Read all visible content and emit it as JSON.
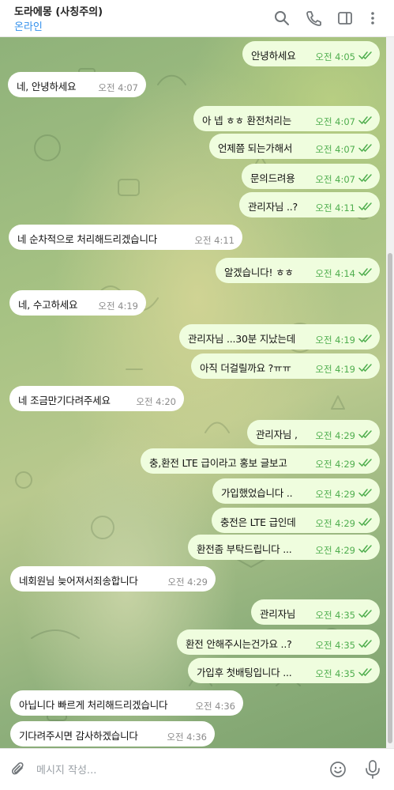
{
  "header": {
    "chat_name": "도라에몽 (사칭주의)",
    "status": "온라인",
    "icons": [
      "search-icon",
      "phone-icon",
      "sidebar-icon",
      "more-icon"
    ]
  },
  "messages": [
    {
      "dir": "out",
      "text": "안녕하세요",
      "time": "오전 4:05",
      "read": true
    },
    {
      "dir": "in",
      "text": "네, 안녕하세요",
      "time": "오전 4:07"
    },
    {
      "dir": "out",
      "text": "아 넵 ㅎㅎ 환전처리는",
      "time": "오전 4:07",
      "read": true
    },
    {
      "dir": "out",
      "text": "언제쯤 되는가해서",
      "time": "오전 4:07",
      "read": true
    },
    {
      "dir": "out",
      "text": "문의드려용",
      "time": "오전 4:07",
      "read": true
    },
    {
      "dir": "out",
      "text": "관리자님 ..?",
      "time": "오전 4:11",
      "read": true
    },
    {
      "dir": "in",
      "text": "네 순차적으로 처리해드리겠습니다",
      "time": "오전 4:11"
    },
    {
      "dir": "out",
      "text": "알겠습니다! ㅎㅎ",
      "time": "오전 4:14",
      "read": true
    },
    {
      "dir": "in",
      "text": "네, 수고하세요",
      "time": "오전 4:19"
    },
    {
      "dir": "out",
      "text": "관리자님 ...30분 지났는데",
      "time": "오전 4:19",
      "read": true
    },
    {
      "dir": "out",
      "text": "아직 더걸릴까요 ?ㅠㅠ",
      "time": "오전 4:19",
      "read": true
    },
    {
      "dir": "in",
      "text": "네 조금만기다려주세요",
      "time": "오전 4:20"
    },
    {
      "dir": "out",
      "text": "관리자님 ,",
      "time": "오전 4:29",
      "read": true
    },
    {
      "dir": "out",
      "text": "충,환전 LTE 급이라고 홍보 글보고",
      "time": "오전 4:29",
      "read": true
    },
    {
      "dir": "out",
      "text": "가입했었습니다 ..",
      "time": "오전 4:29",
      "read": true
    },
    {
      "dir": "out",
      "text": "충전은 LTE 급인데",
      "time": "오전 4:29",
      "read": true
    },
    {
      "dir": "out",
      "text": "환전좀 부탁드립니다 ...",
      "time": "오전 4:29",
      "read": true
    },
    {
      "dir": "in",
      "text": "네회원님 늦어져서죄송합니다",
      "time": "오전 4:29"
    },
    {
      "dir": "out",
      "text": "관리자님",
      "time": "오전 4:35",
      "read": true
    },
    {
      "dir": "out",
      "text": "환전 안해주시는건가요 ..?",
      "time": "오전 4:35",
      "read": true
    },
    {
      "dir": "out",
      "text": "가입후 첫배팅입니다 ...",
      "time": "오전 4:35",
      "read": true
    },
    {
      "dir": "in",
      "text": "아닙니다 빠르게 처리해드리겠습니다",
      "time": "오전 4:36"
    },
    {
      "dir": "in",
      "text": "기다려주시면 감사하겠습니다",
      "time": "오전 4:36"
    }
  ],
  "composer": {
    "placeholder": "메시지 작성...",
    "value": ""
  },
  "colors": {
    "accent": "#3390ec",
    "outgoing_bubble": "#effdde",
    "incoming_bubble": "#ffffff",
    "read_ticks": "#4fae4e"
  }
}
